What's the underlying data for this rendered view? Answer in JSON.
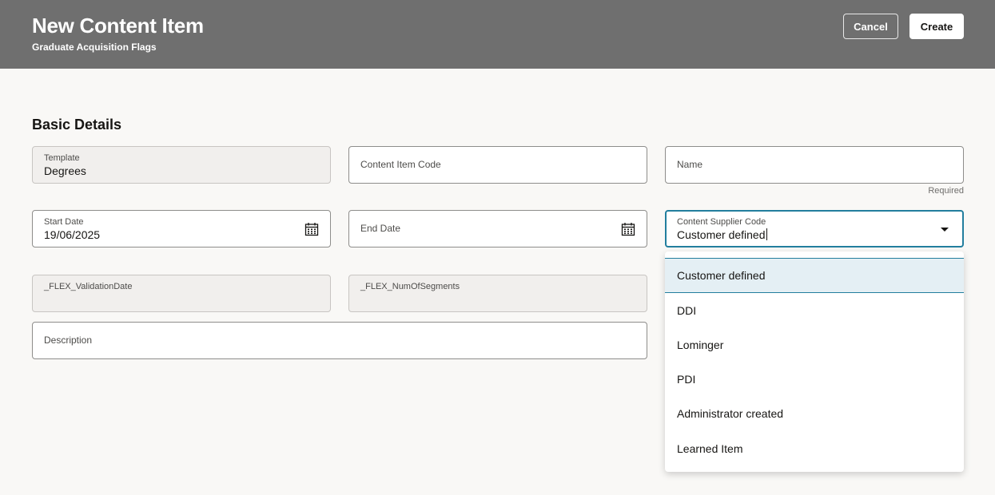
{
  "header": {
    "title": "New Content Item",
    "subtitle": "Graduate Acquisition Flags",
    "cancel_label": "Cancel",
    "create_label": "Create"
  },
  "section": {
    "title": "Basic Details"
  },
  "fields": {
    "template": {
      "label": "Template",
      "value": "Degrees"
    },
    "content_item_code": {
      "label": "Content Item Code"
    },
    "name": {
      "label": "Name",
      "helper": "Required"
    },
    "start_date": {
      "label": "Start Date",
      "value": "19/06/2025"
    },
    "end_date": {
      "label": "End Date"
    },
    "content_supplier_code": {
      "label": "Content Supplier Code",
      "value": "Customer defined"
    },
    "flex_validation_date": {
      "label": "_FLEX_ValidationDate"
    },
    "flex_num_of_segments": {
      "label": "_FLEX_NumOfSegments"
    },
    "description": {
      "label": "Description"
    }
  },
  "dropdown": {
    "options": [
      "Customer defined",
      "DDI",
      "Lominger",
      "PDI",
      "Administrator created",
      "Learned Item"
    ],
    "selected": "Customer defined"
  },
  "icons": {
    "calendar": "calendar-icon",
    "caret": "chevron-down-icon"
  },
  "colors": {
    "header_bg": "#6f6f6f",
    "page_bg": "#f9f8f6",
    "focus_border": "#227e9e",
    "selected_option_bg": "#e4eff4"
  }
}
